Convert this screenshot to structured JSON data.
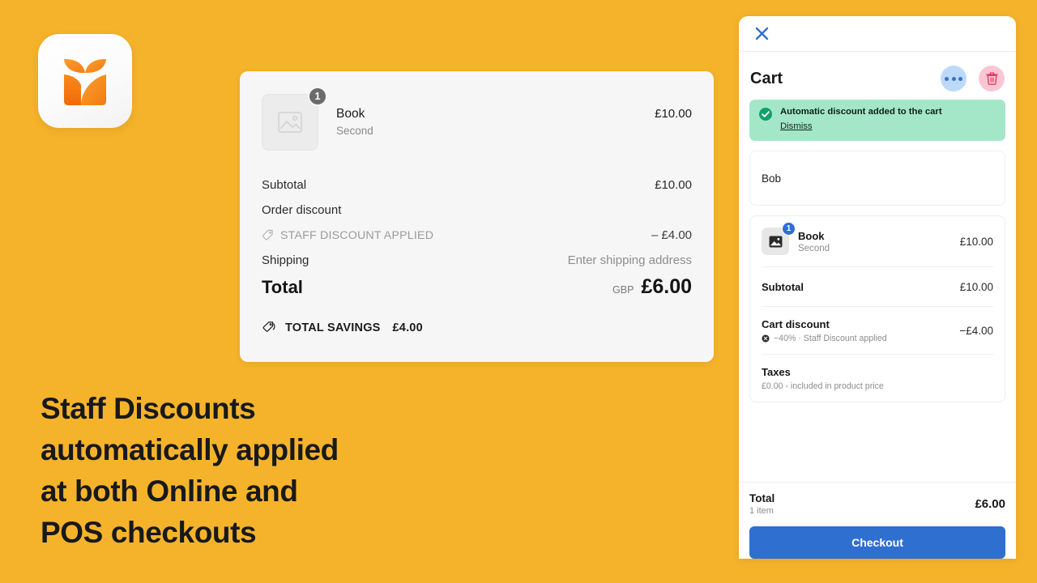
{
  "theme": {
    "background": "#f5b32b",
    "accent_blue": "#2f6fd0",
    "banner_green": "#a3e7c8",
    "danger_pink": "#fbc6d3",
    "danger_red": "#e0315c"
  },
  "logo": {
    "name": "sprout-leaf-logo"
  },
  "headline": {
    "lines": [
      "Staff Discounts",
      "automatically applied",
      "at both Online and",
      "POS checkouts"
    ]
  },
  "online_summary": {
    "product": {
      "title": "Book",
      "variant": "Second",
      "price": "£10.00",
      "quantity": "1",
      "image_placeholder_icon": "image-placeholder-icon"
    },
    "rows": [
      {
        "label": "Subtotal",
        "value": "£10.00"
      },
      {
        "label": "Order discount",
        "value": ""
      }
    ],
    "discount_row": {
      "icon": "discount-tag-icon",
      "label": "STAFF DISCOUNT APPLIED",
      "value": "– £4.00"
    },
    "shipping_row": {
      "label": "Shipping",
      "value": "Enter shipping address"
    },
    "total_row": {
      "label": "Total",
      "currency": "GBP",
      "amount": "£6.00"
    },
    "savings_row": {
      "icon": "savings-tag-icon",
      "label": "TOTAL SAVINGS",
      "amount": "£4.00"
    }
  },
  "pos": {
    "close_icon": "close-icon",
    "title": "Cart",
    "more_button_icon": "more-horizontal-icon",
    "delete_button_icon": "trash-icon",
    "banner": {
      "icon": "check-circle-icon",
      "message": "Automatic discount added to the cart",
      "action": "Dismiss"
    },
    "customer": {
      "name": "Bob"
    },
    "item": {
      "title": "Book",
      "variant": "Second",
      "price": "£10.00",
      "quantity": "1",
      "image_placeholder_icon": "image-placeholder-icon"
    },
    "subtotal": {
      "label": "Subtotal",
      "value": "£10.00"
    },
    "cart_discount": {
      "label": "Cart discount",
      "value": "−£4.00",
      "sub_icon": "discount-remove-icon",
      "sub": "−40% · Staff Discount applied"
    },
    "taxes": {
      "label": "Taxes",
      "sub": "£0.00 - included in product price"
    },
    "footer": {
      "total_label": "Total",
      "item_count": "1 item",
      "total_amount": "£6.00",
      "checkout_label": "Checkout"
    }
  }
}
